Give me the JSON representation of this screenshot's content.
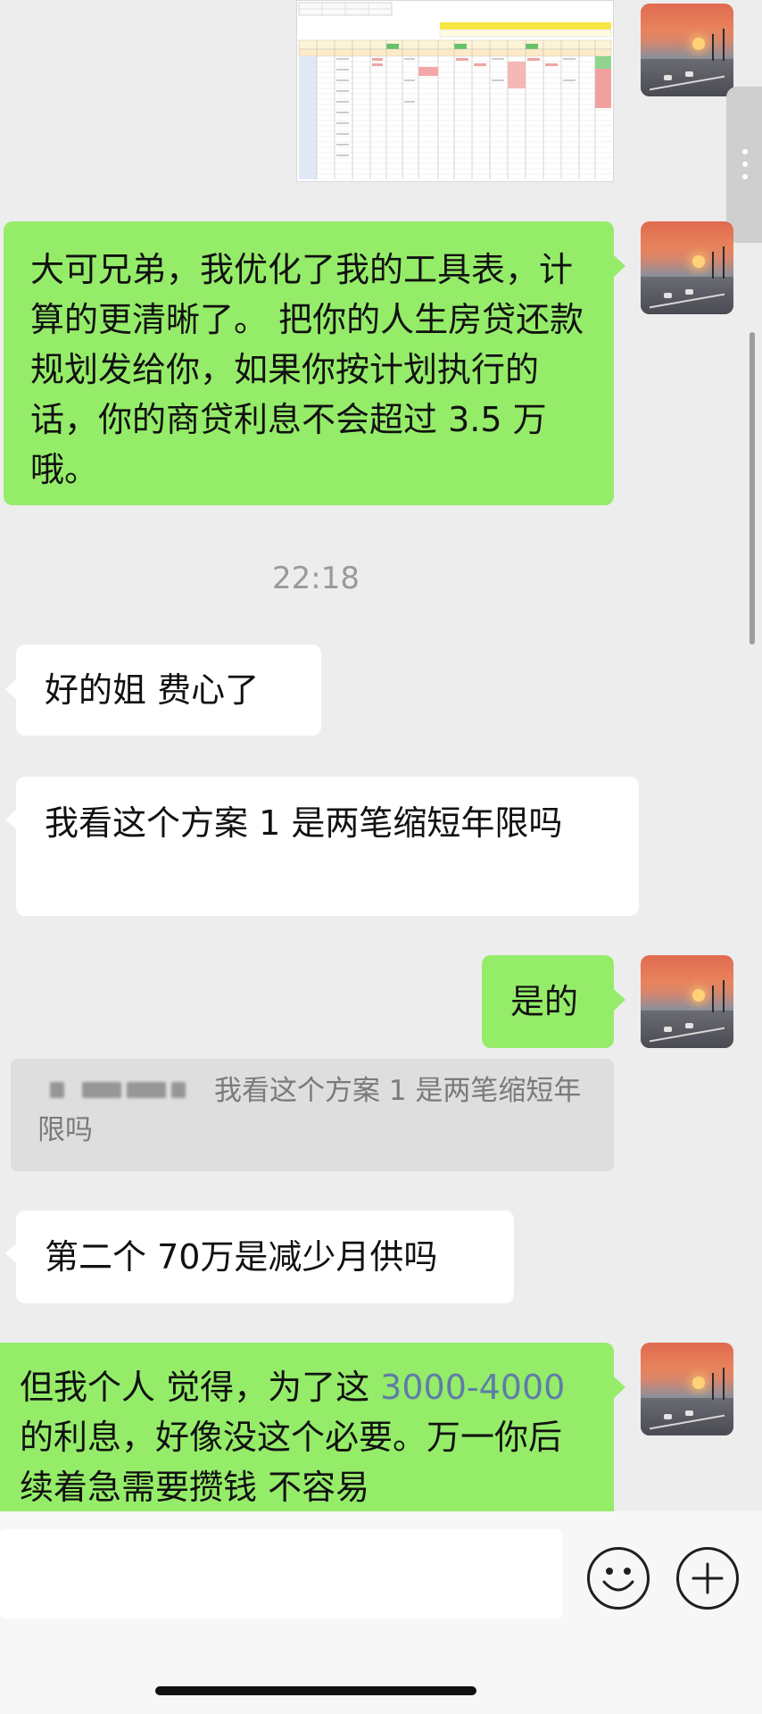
{
  "messages": {
    "m1_text": "大可兄弟，我优化了我的工具表，计算的更清晰了。 把你的人生房贷还款规划发给你，如果你按计划执行的话，你的商贷利息不会超过 3.5 万哦。",
    "time_label": "22:18",
    "m2_text": "好的姐 费心了",
    "m3_text": "我看这个方案 1 是两笔缩短年限吗",
    "m4_text": "是的",
    "quote_text": "我看这个方案 1 是两笔缩短年限吗",
    "m5_text": "第二个 70万是减少月供吗",
    "m6_part1": "但我个人 觉得，为了这 ",
    "m6_link": "3000-4000",
    "m6_part2": "的利息，好像没这个必要。万一你后续着急需要攒钱 不容易"
  },
  "icons": {
    "emoji": "emoji-icon",
    "plus": "plus-icon",
    "more": "more-dots-icon"
  },
  "colors": {
    "background": "#ededed",
    "bubble_green": "#95ec69",
    "bubble_white": "#ffffff",
    "link": "#5f7da8",
    "time": "#9a9a9a"
  }
}
